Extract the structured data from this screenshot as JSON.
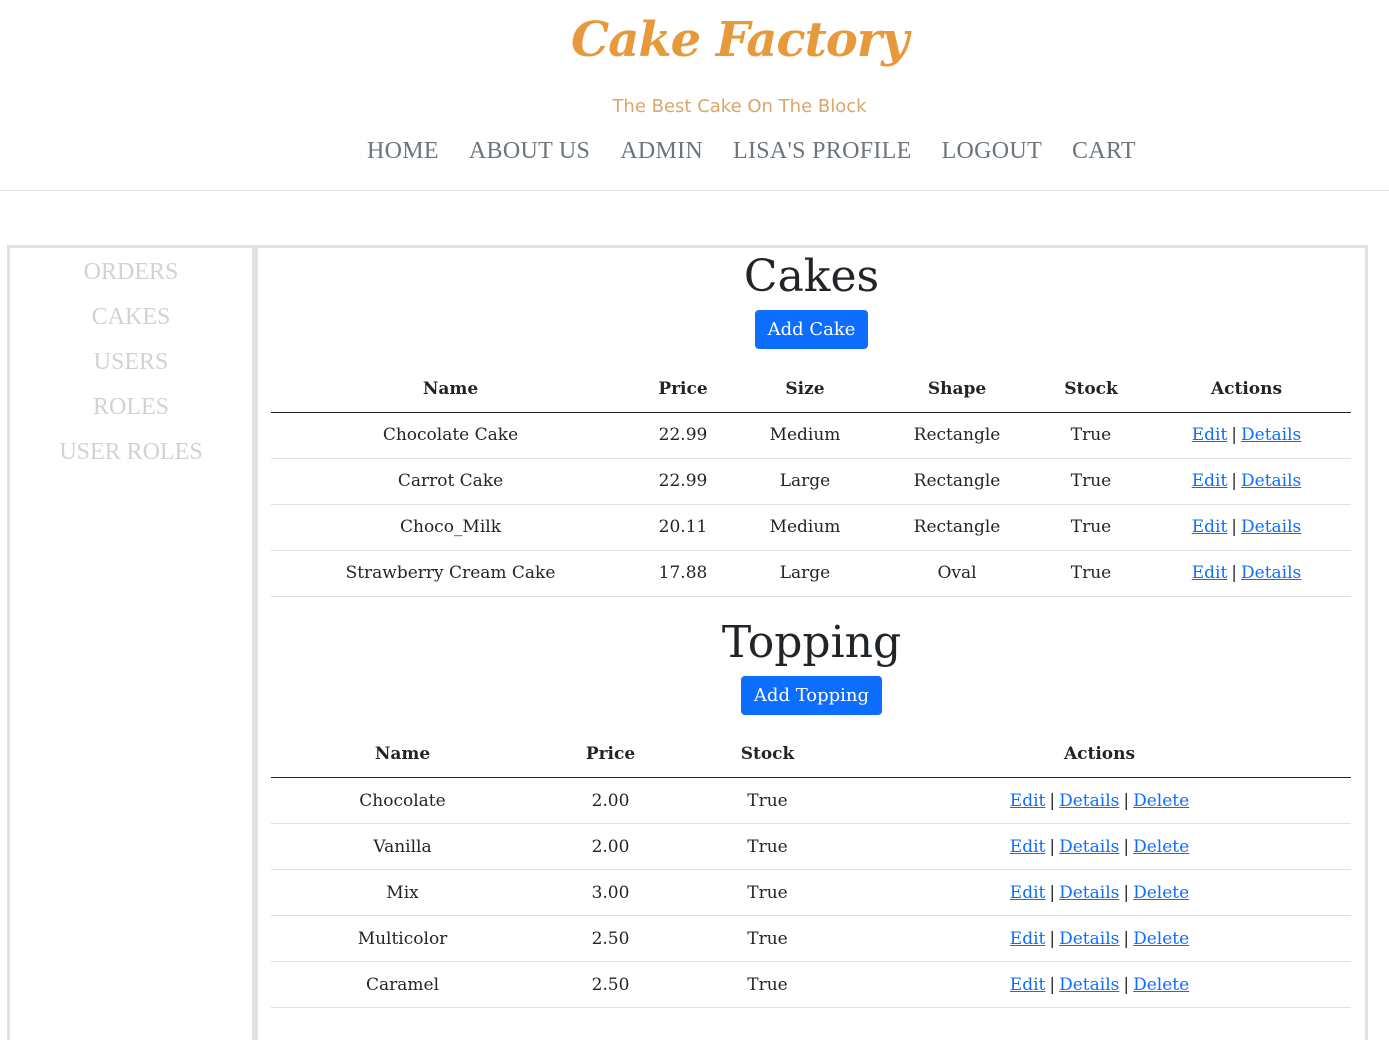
{
  "header": {
    "brand": "Cake Factory",
    "tagline": "The Best Cake On The Block",
    "nav": [
      "HOME",
      "ABOUT US",
      "ADMIN",
      "LISA'S PROFILE",
      "LOGOUT",
      "CART"
    ]
  },
  "sidebar": {
    "items": [
      "ORDERS",
      "CAKES",
      "USERS",
      "ROLES",
      "USER ROLES"
    ]
  },
  "cakes": {
    "title": "Cakes",
    "add_button": "Add Cake",
    "headers": [
      "Name",
      "Price",
      "Size",
      "Shape",
      "Stock",
      "Actions"
    ],
    "rows": [
      {
        "name": "Chocolate Cake",
        "price": "22.99",
        "size": "Medium",
        "shape": "Rectangle",
        "stock": "True"
      },
      {
        "name": "Carrot Cake",
        "price": "22.99",
        "size": "Large",
        "shape": "Rectangle",
        "stock": "True"
      },
      {
        "name": "Choco_Milk",
        "price": "20.11",
        "size": "Medium",
        "shape": "Rectangle",
        "stock": "True"
      },
      {
        "name": "Strawberry Cream Cake",
        "price": "17.88",
        "size": "Large",
        "shape": "Oval",
        "stock": "True"
      }
    ],
    "actions": {
      "edit": "Edit",
      "details": "Details",
      "sep": "|"
    }
  },
  "topping": {
    "title": "Topping",
    "add_button": "Add Topping",
    "headers": [
      "Name",
      "Price",
      "Stock",
      "Actions"
    ],
    "rows": [
      {
        "name": "Chocolate",
        "price": "2.00",
        "stock": "True"
      },
      {
        "name": "Vanilla",
        "price": "2.00",
        "stock": "True"
      },
      {
        "name": "Mix",
        "price": "3.00",
        "stock": "True"
      },
      {
        "name": "Multicolor",
        "price": "2.50",
        "stock": "True"
      },
      {
        "name": "Caramel",
        "price": "2.50",
        "stock": "True"
      }
    ],
    "actions": {
      "edit": "Edit",
      "details": "Details",
      "delete": "Delete",
      "sep": "|"
    }
  },
  "colors": {
    "brand": "#e69a3c",
    "tagline": "#d9a66b",
    "primary": "#0d6efd",
    "nav": "#6c757d",
    "sidebar": "#cfd2d6"
  }
}
